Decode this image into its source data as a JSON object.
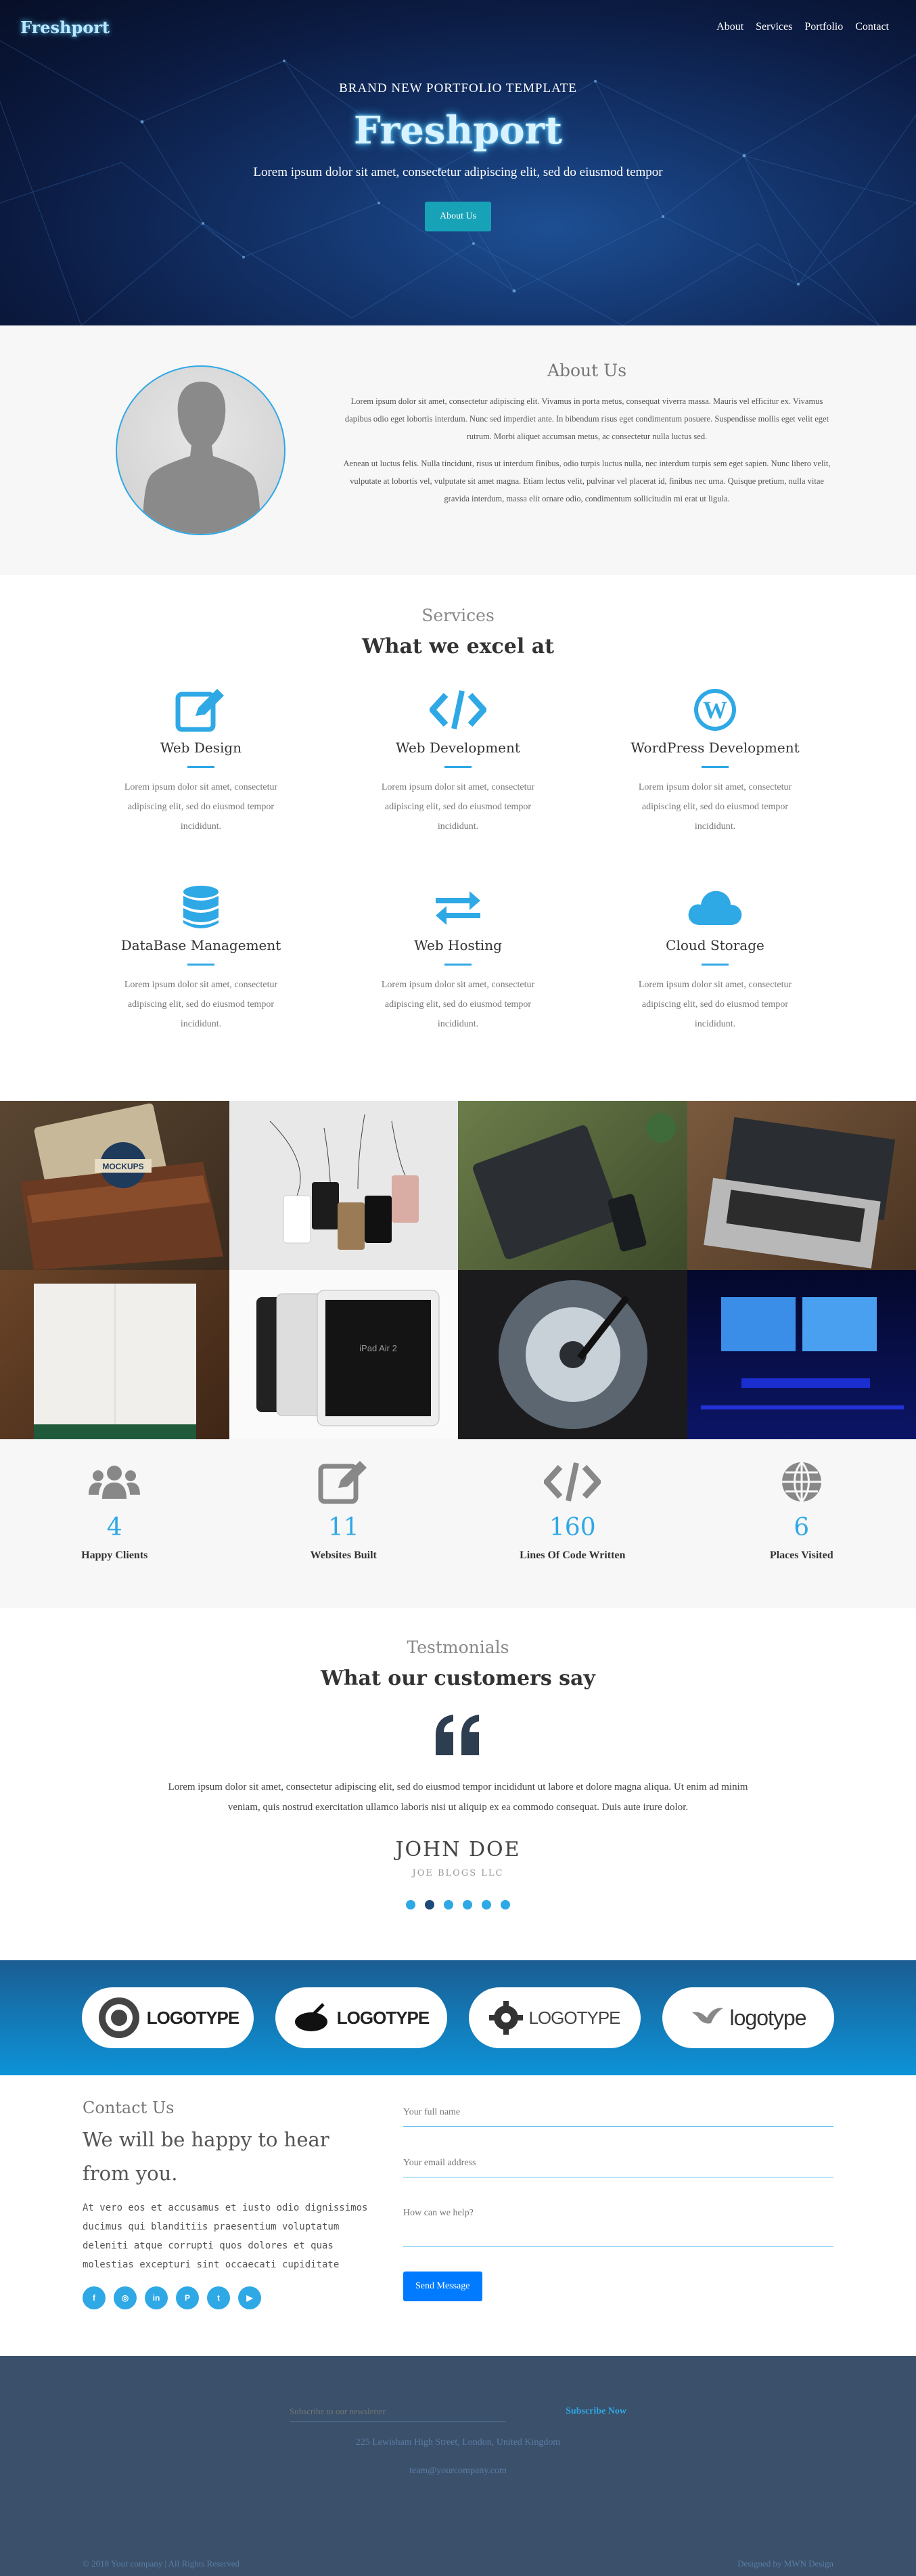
{
  "nav": {
    "logo": "Freshport",
    "links": [
      "About",
      "Services",
      "Portfolio",
      "Contact"
    ]
  },
  "hero": {
    "kicker": "BRAND NEW PORTFOLIO TEMPLATE",
    "title": "Freshport",
    "subtitle": "Lorem ipsum dolor sit amet, consectetur adipiscing elit, sed do eiusmod tempor",
    "button": "About Us"
  },
  "about": {
    "title": "About Us",
    "p1": "Lorem ipsum dolor sit amet, consectetur adipiscing elit. Vivamus in porta metus, consequat viverra massa. Mauris vel efficitur ex. Vivamus dapibus odio eget lobortis interdum. Nunc sed imperdiet ante. In bibendum risus eget condimentum posuere. Suspendisse mollis eget velit eget rutrum. Morbi aliquet accumsan metus, ac consectetur nulla luctus sed.",
    "p2": "Aenean ut luctus felis. Nulla tincidunt, risus ut interdum finibus, odio turpis luctus nulla, nec interdum turpis sem eget sapien. Nunc libero velit, vulputate at lobortis vel, vulputate sit amet magna. Etiam lectus velit, pulvinar vel placerat id, finibus nec urna. Quisque pretium, nulla vitae gravida interdum, massa elit ornare odio, condimentum sollicitudin mi erat ut ligula."
  },
  "services": {
    "kicker": "Services",
    "title": "What we excel at",
    "items": [
      {
        "title": "Web Design",
        "desc": "Lorem ipsum dolor sit amet, consectetur adipiscing elit, sed do eiusmod tempor incididunt.",
        "icon": "edit-icon"
      },
      {
        "title": "Web Development",
        "desc": "Lorem ipsum dolor sit amet, consectetur adipiscing elit, sed do eiusmod tempor incididunt.",
        "icon": "code-icon"
      },
      {
        "title": "WordPress Development",
        "desc": "Lorem ipsum dolor sit amet, consectetur adipiscing elit, sed do eiusmod tempor incididunt.",
        "icon": "wordpress-icon"
      },
      {
        "title": "DataBase Management",
        "desc": "Lorem ipsum dolor sit amet, consectetur adipiscing elit, sed do eiusmod tempor incididunt.",
        "icon": "database-icon"
      },
      {
        "title": "Web Hosting",
        "desc": "Lorem ipsum dolor sit amet, consectetur adipiscing elit, sed do eiusmod tempor incididunt.",
        "icon": "exchange-icon"
      },
      {
        "title": "Cloud Storage",
        "desc": "Lorem ipsum dolor sit amet, consectetur adipiscing elit, sed do eiusmod tempor incididunt.",
        "icon": "cloud-icon"
      }
    ]
  },
  "gallery": {
    "mockup_badge": "MOCKUPS",
    "tablet_text": "iPad Air 2"
  },
  "stats": [
    {
      "value": "4",
      "label": "Happy Clients",
      "icon": "users-icon"
    },
    {
      "value": "11",
      "label": "Websites Built",
      "icon": "edit-icon"
    },
    {
      "value": "160",
      "label": "Lines Of Code Written",
      "icon": "code-icon"
    },
    {
      "value": "6",
      "label": "Places Visited",
      "icon": "globe-icon"
    }
  ],
  "testimonials": {
    "kicker": "Testmonials",
    "title": "What our customers say",
    "text": "Lorem ipsum dolor sit amet, consectetur adipiscing elit, sed do eiusmod tempor incididunt ut labore et dolore magna aliqua. Ut enim ad minim veniam, quis nostrud exercitation ullamco laboris nisi ut aliquip ex ea commodo consequat. Duis aute irure dolor.",
    "name": "JOHN DOE",
    "company": "JOE BLOGS LLC",
    "dots": 6,
    "active_dot": 1
  },
  "logos": [
    "LOGOTYPE",
    "LOGOTYPE",
    "LOGOTYPE",
    "logotype"
  ],
  "contact": {
    "kicker": "Contact Us",
    "title": "We will be happy to hear from you.",
    "text": "At vero eos et accusamus et iusto odio dignissimos ducimus qui blanditiis praesentium voluptatum deleniti atque corrupti quos dolores et quas molestias excepturi sint occaecati cupiditate",
    "socials": [
      "facebook-icon",
      "instagram-icon",
      "linkedin-icon",
      "pinterest-icon",
      "twitter-icon",
      "youtube-icon"
    ],
    "name_placeholder": "Your full name",
    "email_placeholder": "Your email address",
    "message_placeholder": "How can we help?",
    "button": "Send Message"
  },
  "footer": {
    "subscribe_placeholder": "Subscribe to our newsletter",
    "subscribe_button": "Subscribe Now",
    "address": "225 Lewisham High Street, London, United Kingdom",
    "email": "team@yourcompany.com",
    "copyright": "© 2018 Your company | All Rights Reserved",
    "credit": "Designed by MWN Design"
  },
  "colors": {
    "accent": "#2fa8e6",
    "footer_bg": "#3a506b",
    "hero_bg": "#0b1a40"
  }
}
